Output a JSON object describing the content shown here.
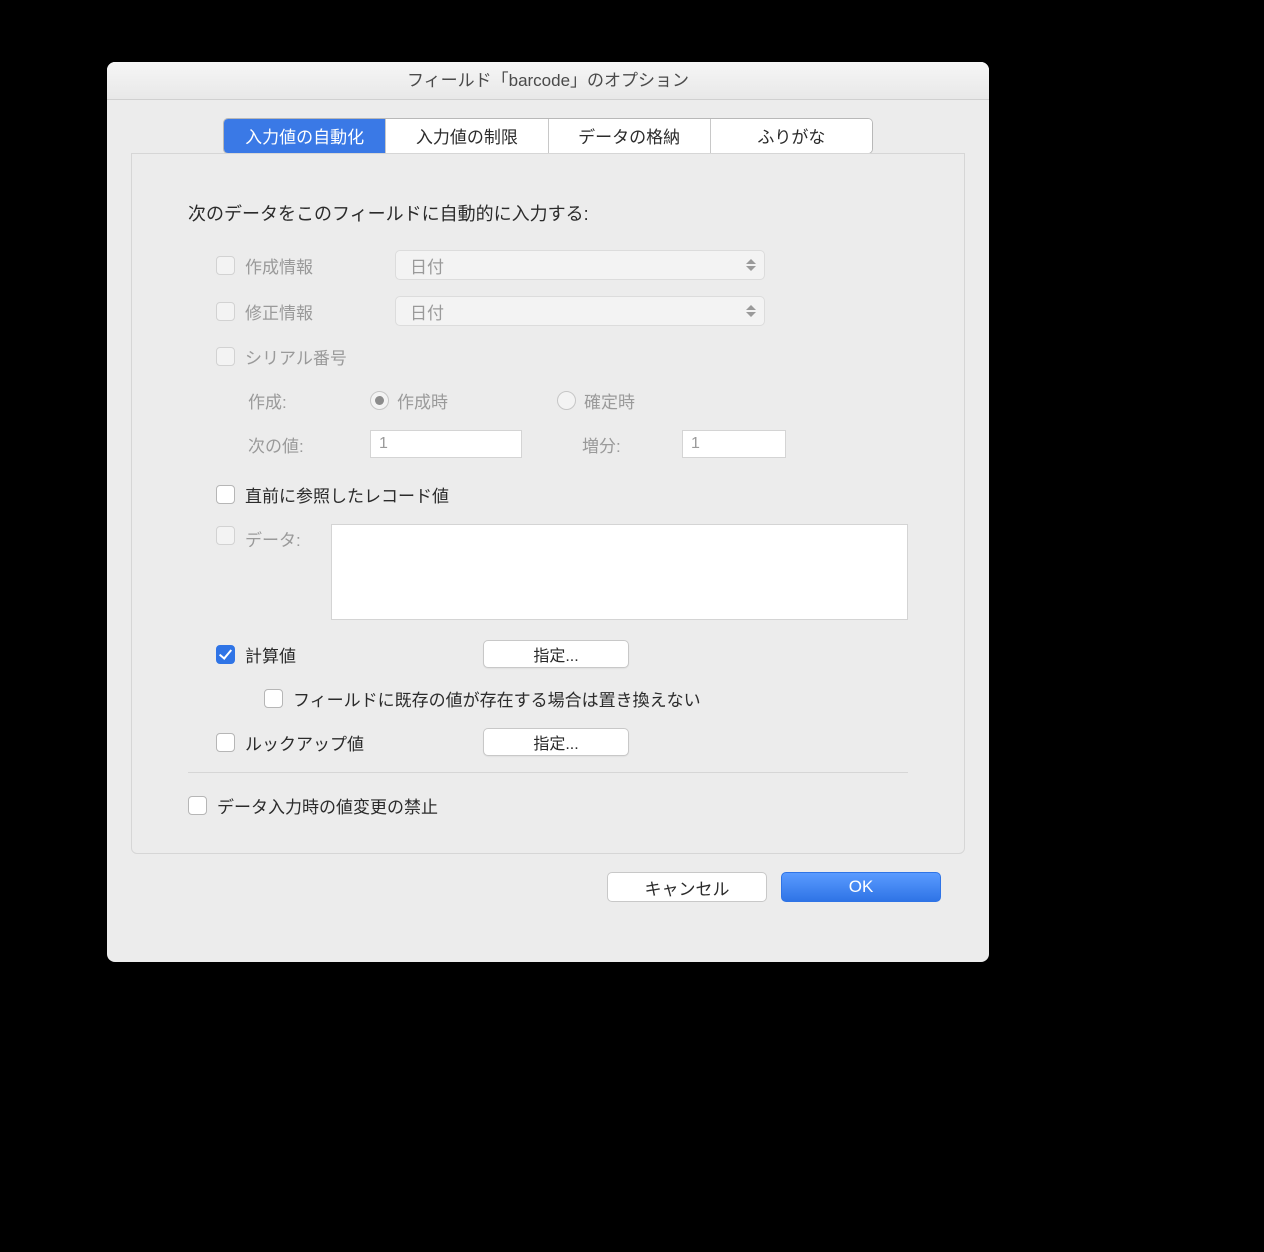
{
  "title": "フィールド「barcode」のオプション",
  "tabs": [
    "入力値の自動化",
    "入力値の制限",
    "データの格納",
    "ふりがな"
  ],
  "heading": "次のデータをこのフィールドに自動的に入力する:",
  "creation": {
    "label": "作成情報",
    "select": "日付"
  },
  "modification": {
    "label": "修正情報",
    "select": "日付"
  },
  "serial": {
    "label": "シリアル番号",
    "generateLabel": "作成:",
    "onCreate": "作成時",
    "onCommit": "確定時",
    "nextLabel": "次の値:",
    "nextValue": "1",
    "incrLabel": "増分:",
    "incrValue": "1"
  },
  "lastVisited": "直前に参照したレコード値",
  "dataLabel": "データ:",
  "calc": {
    "label": "計算値",
    "specify": "指定..."
  },
  "noReplace": "フィールドに既存の値が存在する場合は置き換えない",
  "lookup": {
    "label": "ルックアップ値",
    "specify": "指定..."
  },
  "prohibit": "データ入力時の値変更の禁止",
  "cancel": "キャンセル",
  "ok": "OK"
}
